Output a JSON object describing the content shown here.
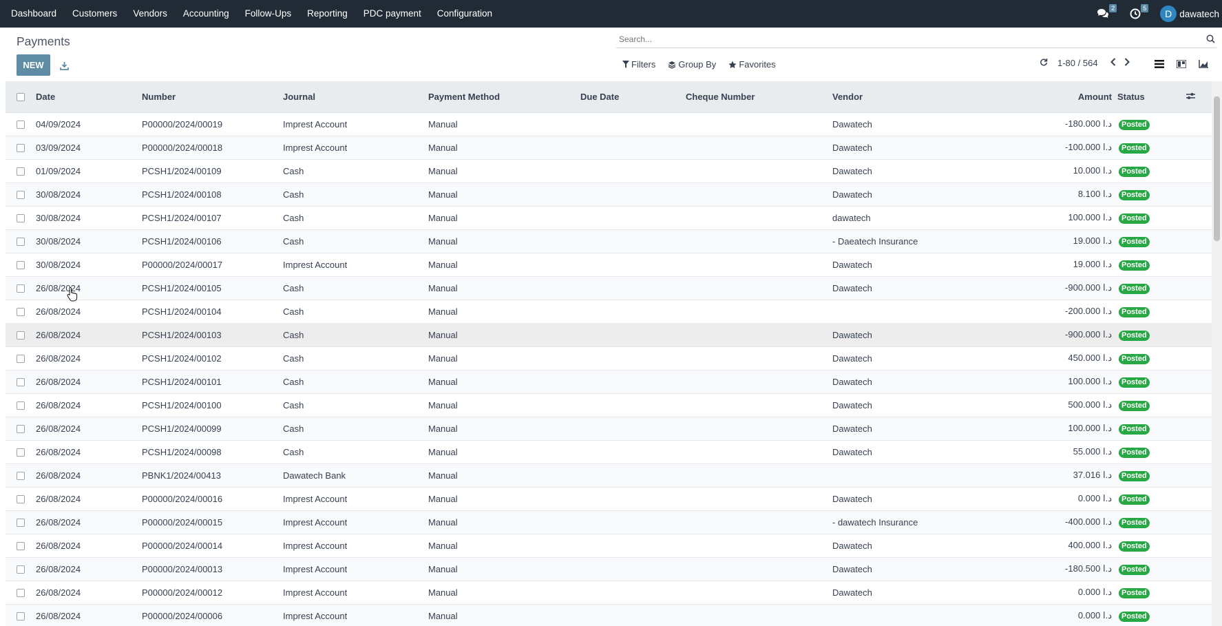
{
  "topbar": {
    "menu": [
      "Dashboard",
      "Customers",
      "Vendors",
      "Accounting",
      "Follow-Ups",
      "Reporting",
      "PDC payment",
      "Configuration"
    ],
    "messages_count": "2",
    "activities_count": "5",
    "user_initial": "D",
    "user_name": "dawatech"
  },
  "control": {
    "title": "Payments",
    "new_label": "NEW",
    "search_placeholder": "Search...",
    "filters_label": "Filters",
    "groupby_label": "Group By",
    "favorites_label": "Favorites",
    "pager_value": "1-80 / 564"
  },
  "table": {
    "headers": {
      "date": "Date",
      "number": "Number",
      "journal": "Journal",
      "method": "Payment Method",
      "due": "Due Date",
      "cheque": "Cheque Number",
      "vendor": "Vendor",
      "amount": "Amount",
      "status": "Status"
    },
    "currency": "د.ا",
    "rows": [
      {
        "date": "04/09/2024",
        "number": "P00000/2024/00019",
        "journal": "Imprest Account",
        "method": "Manual",
        "vendor": "Dawatech",
        "amount": "-180.000",
        "status": "Posted"
      },
      {
        "date": "03/09/2024",
        "number": "P00000/2024/00018",
        "journal": "Imprest Account",
        "method": "Manual",
        "vendor": "Dawatech",
        "amount": "-100.000",
        "status": "Posted"
      },
      {
        "date": "01/09/2024",
        "number": "PCSH1/2024/00109",
        "journal": "Cash",
        "method": "Manual",
        "vendor": "Dawatech",
        "amount": "10.000",
        "status": "Posted"
      },
      {
        "date": "30/08/2024",
        "number": "PCSH1/2024/00108",
        "journal": "Cash",
        "method": "Manual",
        "vendor": "Dawatech",
        "amount": "8.100",
        "status": "Posted"
      },
      {
        "date": "30/08/2024",
        "number": "PCSH1/2024/00107",
        "journal": "Cash",
        "method": "Manual",
        "vendor": "dawatech",
        "amount": "100.000",
        "status": "Posted"
      },
      {
        "date": "30/08/2024",
        "number": "PCSH1/2024/00106",
        "journal": "Cash",
        "method": "Manual",
        "vendor": "- Daeatech Insurance",
        "amount": "19.000",
        "status": "Posted"
      },
      {
        "date": "30/08/2024",
        "number": "P00000/2024/00017",
        "journal": "Imprest Account",
        "method": "Manual",
        "vendor": "Dawatech",
        "amount": "19.000",
        "status": "Posted"
      },
      {
        "date": "26/08/2024",
        "number": "PCSH1/2024/00105",
        "journal": "Cash",
        "method": "Manual",
        "vendor": "Dawatech",
        "amount": "-900.000",
        "status": "Posted"
      },
      {
        "date": "26/08/2024",
        "number": "PCSH1/2024/00104",
        "journal": "Cash",
        "method": "Manual",
        "vendor": "",
        "amount": "-200.000",
        "status": "Posted"
      },
      {
        "date": "26/08/2024",
        "number": "PCSH1/2024/00103",
        "journal": "Cash",
        "method": "Manual",
        "vendor": "Dawatech",
        "amount": "-900.000",
        "status": "Posted"
      },
      {
        "date": "26/08/2024",
        "number": "PCSH1/2024/00102",
        "journal": "Cash",
        "method": "Manual",
        "vendor": "Dawatech",
        "amount": "450.000",
        "status": "Posted"
      },
      {
        "date": "26/08/2024",
        "number": "PCSH1/2024/00101",
        "journal": "Cash",
        "method": "Manual",
        "vendor": "Dawatech",
        "amount": "100.000",
        "status": "Posted"
      },
      {
        "date": "26/08/2024",
        "number": "PCSH1/2024/00100",
        "journal": "Cash",
        "method": "Manual",
        "vendor": "Dawatech",
        "amount": "500.000",
        "status": "Posted"
      },
      {
        "date": "26/08/2024",
        "number": "PCSH1/2024/00099",
        "journal": "Cash",
        "method": "Manual",
        "vendor": "Dawatech",
        "amount": "100.000",
        "status": "Posted"
      },
      {
        "date": "26/08/2024",
        "number": "PCSH1/2024/00098",
        "journal": "Cash",
        "method": "Manual",
        "vendor": "Dawatech",
        "amount": "55.000",
        "status": "Posted"
      },
      {
        "date": "26/08/2024",
        "number": "PBNK1/2024/00413",
        "journal": "Dawatech Bank",
        "method": "Manual",
        "vendor": "",
        "amount": "37.016",
        "status": "Posted"
      },
      {
        "date": "26/08/2024",
        "number": "P00000/2024/00016",
        "journal": "Imprest Account",
        "method": "Manual",
        "vendor": "Dawatech",
        "amount": "0.000",
        "status": "Posted"
      },
      {
        "date": "26/08/2024",
        "number": "P00000/2024/00015",
        "journal": "Imprest Account",
        "method": "Manual",
        "vendor": "- dawatech Insurance",
        "amount": "-400.000",
        "status": "Posted"
      },
      {
        "date": "26/08/2024",
        "number": "P00000/2024/00014",
        "journal": "Imprest Account",
        "method": "Manual",
        "vendor": "Dawatech",
        "amount": "400.000",
        "status": "Posted"
      },
      {
        "date": "26/08/2024",
        "number": "P00000/2024/00013",
        "journal": "Imprest Account",
        "method": "Manual",
        "vendor": "Dawatech",
        "amount": "-180.500",
        "status": "Posted"
      },
      {
        "date": "26/08/2024",
        "number": "P00000/2024/00012",
        "journal": "Imprest Account",
        "method": "Manual",
        "vendor": "Dawatech",
        "amount": "0.000",
        "status": "Posted"
      },
      {
        "date": "26/08/2024",
        "number": "P00000/2024/00006",
        "journal": "Imprest Account",
        "method": "Manual",
        "vendor": "",
        "amount": "0.000",
        "status": "Posted"
      }
    ]
  },
  "colors": {
    "topbar_bg": "#212b36",
    "primary_button": "#5f8ca5",
    "posted_badge": "#28a745"
  }
}
